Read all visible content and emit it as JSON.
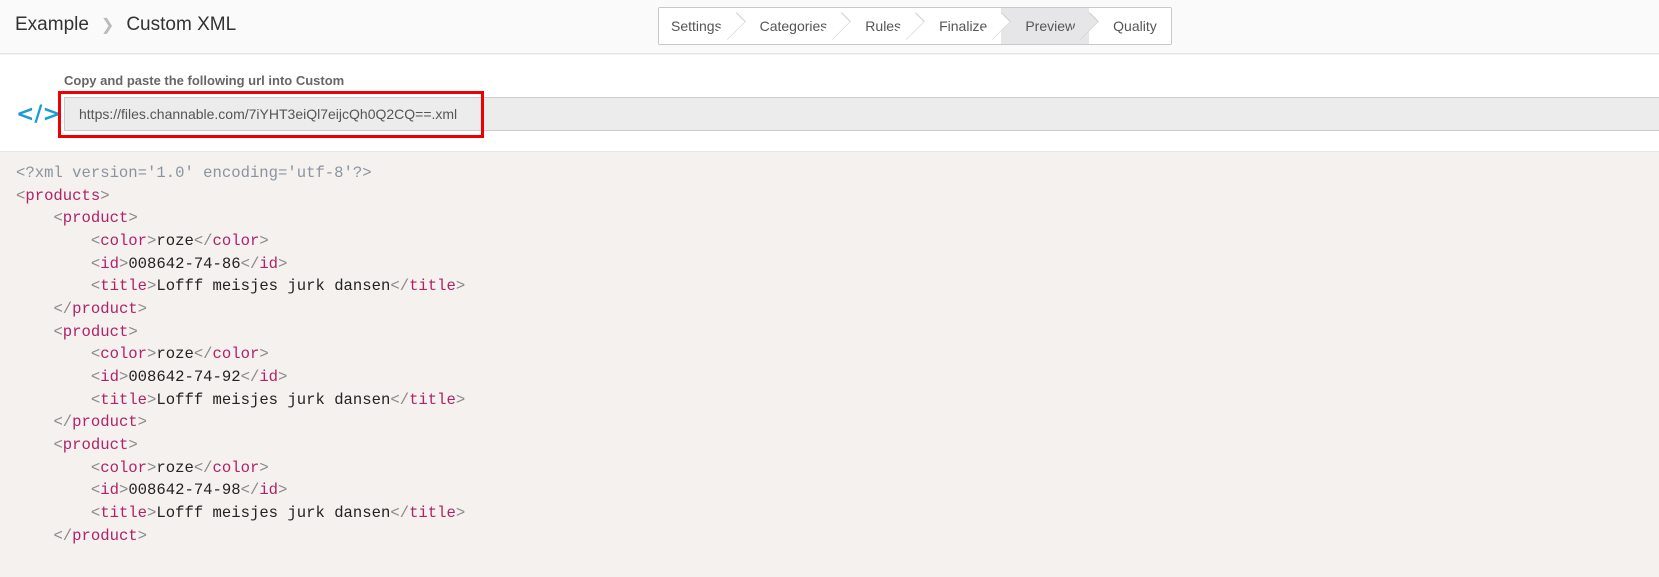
{
  "breadcrumb": {
    "parent": "Example",
    "current": "Custom XML"
  },
  "steps": [
    {
      "label": "Settings"
    },
    {
      "label": "Categories"
    },
    {
      "label": "Rules"
    },
    {
      "label": "Finalize"
    },
    {
      "label": "Preview",
      "active": true
    },
    {
      "label": "Quality"
    }
  ],
  "url_panel": {
    "label": "Copy and paste the following url into Custom",
    "url": "https://files.channable.com/7iYHT3eiQl7eijcQh0Q2CQ==.xml",
    "icon": "code-icon",
    "accent": "#1a9ad6",
    "highlight": "#e00000"
  },
  "xml": {
    "declaration": "<?xml version='1.0' encoding='utf-8'?>",
    "root": "products",
    "products": [
      {
        "tag": "product",
        "fields": [
          {
            "tag": "color",
            "value": "roze"
          },
          {
            "tag": "id",
            "value": "008642-74-86"
          },
          {
            "tag": "title",
            "value": "Lofff meisjes jurk dansen"
          }
        ]
      },
      {
        "tag": "product",
        "fields": [
          {
            "tag": "color",
            "value": "roze"
          },
          {
            "tag": "id",
            "value": "008642-74-92"
          },
          {
            "tag": "title",
            "value": "Lofff meisjes jurk dansen"
          }
        ]
      },
      {
        "tag": "product",
        "fields": [
          {
            "tag": "color",
            "value": "roze"
          },
          {
            "tag": "id",
            "value": "008642-74-98"
          },
          {
            "tag": "title",
            "value": "Lofff meisjes jurk dansen"
          }
        ]
      }
    ]
  }
}
